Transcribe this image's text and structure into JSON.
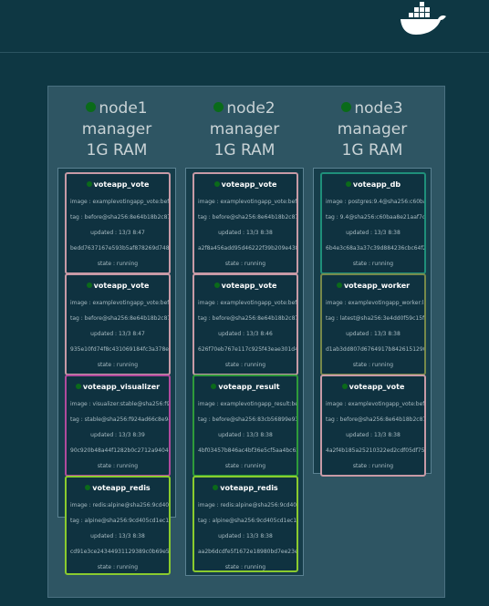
{
  "logo": {
    "icon": "docker-whale-icon"
  },
  "nodes": [
    {
      "name": "node1",
      "role": "manager",
      "ram": "1G RAM",
      "status_color": "#0a6b19",
      "services": [
        {
          "name": "voteapp_vote",
          "image": "image : examplevotingapp_vote:befo",
          "tag": "tag : before@sha256:8e64b18b2c87",
          "updated": "updated : 13/3 8:47",
          "id": "bedd7637167e593b5af878269d748",
          "state": "state : running",
          "border": "pink"
        },
        {
          "name": "voteapp_vote",
          "image": "image : examplevotingapp_vote:befo",
          "tag": "tag : before@sha256:8e64b18b2c87",
          "updated": "updated : 13/3 8:47",
          "id": "935e10fd74f8c431069184fc3a378e4",
          "state": "state : running",
          "border": "pink"
        },
        {
          "name": "voteapp_visualizer",
          "image": "image : visualizer:stable@sha256:f9",
          "tag": "tag : stable@sha256:f924ad66c8e94",
          "updated": "updated : 13/3 8:39",
          "id": "90c920b48a44f1282b0c2712a94041",
          "state": "state : running",
          "border": "purple"
        },
        {
          "name": "voteapp_redis",
          "image": "image : redis:alpine@sha256:9cd405",
          "tag": "tag : alpine@sha256:9cd405cd1ec14",
          "updated": "updated : 13/3 8:38",
          "id": "cd91e3ce24344931129389c0b69e53",
          "state": "state : running",
          "border": "lime"
        }
      ]
    },
    {
      "name": "node2",
      "role": "manager",
      "ram": "1G RAM",
      "status_color": "#0a6b19",
      "services": [
        {
          "name": "voteapp_vote",
          "image": "image : examplevotingapp_vote:befo",
          "tag": "tag : before@sha256:8e64b18b2c87",
          "updated": "updated : 13/3 8:38",
          "id": "a2f8a456add95d46222f39b209e438",
          "state": "state : running",
          "border": "pink"
        },
        {
          "name": "voteapp_vote",
          "image": "image : examplevotingapp_vote:befo",
          "tag": "tag : before@sha256:8e64b18b2c87",
          "updated": "updated : 13/3 8:46",
          "id": "626f70eb767e117c925f43eae301d4",
          "state": "state : running",
          "border": "pink"
        },
        {
          "name": "voteapp_result",
          "image": "image : examplevotingapp_result:befo",
          "tag": "tag : before@sha256:83cb56899e93",
          "updated": "updated : 13/3 8:38",
          "id": "4bf03457b846ac4bf36e5cf5aa4bc62",
          "state": "state : running",
          "border": "green"
        },
        {
          "name": "voteapp_redis",
          "image": "image : redis:alpine@sha256:9cd405",
          "tag": "tag : alpine@sha256:9cd405cd1ec14",
          "updated": "updated : 13/3 8:38",
          "id": "aa2b6dcdfe5f1672e18980bd7ee23e",
          "state": "state : running",
          "border": "lime"
        }
      ]
    },
    {
      "name": "node3",
      "role": "manager",
      "ram": "1G RAM",
      "status_color": "#0a6b19",
      "services": [
        {
          "name": "voteapp_db",
          "image": "image : postgres:9.4@sha256:c60ba",
          "tag": "tag : 9.4@sha256:c60baa8e21aaf7c2",
          "updated": "updated : 13/3 8:38",
          "id": "6b4e3c68a3a37c39d884236cbc64f2",
          "state": "state : running",
          "border": "teal"
        },
        {
          "name": "voteapp_worker",
          "image": "image : examplevotingapp_worker:la",
          "tag": "tag : latest@sha256:3e4dd0f59c15f4",
          "updated": "updated : 13/3 8:38",
          "id": "d1ab3dd807d6764917b8426151290",
          "state": "state : running",
          "border": "olive"
        },
        {
          "name": "voteapp_vote",
          "image": "image : examplevotingapp_vote:befo",
          "tag": "tag : before@sha256:8e64b18b2c87",
          "updated": "updated : 13/3 8:38",
          "id": "4a2f4b185a25210322ed2cdf05df752",
          "state": "state : running",
          "border": "pink"
        }
      ]
    }
  ]
}
